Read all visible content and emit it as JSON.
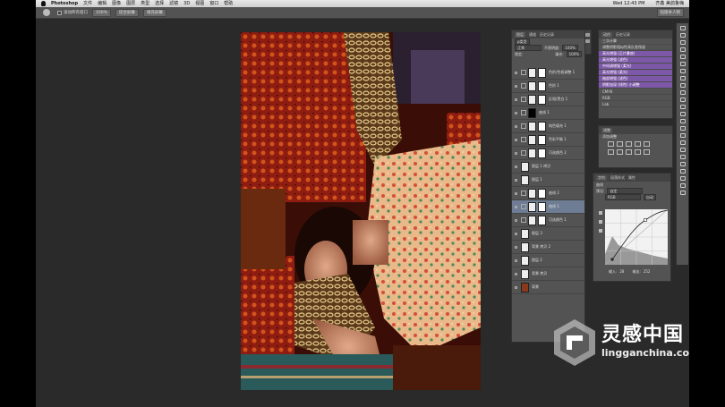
{
  "menubar": {
    "app": "Photoshop",
    "items": [
      "文件",
      "编辑",
      "图像",
      "图层",
      "类型",
      "选择",
      "滤镜",
      "3D",
      "视图",
      "窗口",
      "帮助"
    ],
    "clock": "Wed 12:43 PM",
    "user": "齐鑫 美鸽鲁嗨"
  },
  "options": {
    "checkbox_label": "滚动所有窗口",
    "btn1": "100%",
    "btn2": "适合屏幕",
    "btn3": "填充屏幕",
    "workspace": "短版本人物"
  },
  "layers_panel": {
    "tabs": [
      "图层",
      "通道",
      "历史记录"
    ],
    "kind": "ρ类型",
    "blend": "正常",
    "opacity_label": "不透明度:",
    "opacity": "100%",
    "lock_label": "锁定:",
    "fill_label": "填充:",
    "fill": "100%",
    "layers": [
      {
        "name": "色阶/色相调整 1",
        "type": "adj"
      },
      {
        "name": "色阶 1",
        "type": "adj"
      },
      {
        "name": "反相/黑白 1",
        "type": "grad"
      },
      {
        "name": "曲线 1",
        "type": "black"
      },
      {
        "name": "纯色填充 1",
        "type": "adj"
      },
      {
        "name": "色彩平衡 1",
        "type": "adj"
      },
      {
        "name": "可选颜色 2",
        "type": "adj"
      },
      {
        "name": "图层 1 拷贝",
        "type": "plain"
      },
      {
        "name": "图层 1",
        "type": "plain"
      },
      {
        "name": "曲线 2",
        "type": "adj"
      },
      {
        "name": "曲线 1",
        "type": "adj"
      },
      {
        "name": "可选颜色 1",
        "type": "adj"
      },
      {
        "name": "图层 3",
        "type": "plain"
      },
      {
        "name": "背景 拷贝 2",
        "type": "plain"
      },
      {
        "name": "图层 2",
        "type": "plain"
      },
      {
        "name": "背景 拷贝",
        "type": "plain"
      },
      {
        "name": "背景",
        "type": "photo"
      }
    ]
  },
  "history_panel": {
    "tabs": [
      "动作",
      "历史记录"
    ],
    "items": [
      {
        "label": "三次计算",
        "hl": false
      },
      {
        "label": "调整阴影相似性高反差保留",
        "hl": false
      },
      {
        "label": "高光增强 (正片叠底)",
        "hl": true
      },
      {
        "label": "高光增强 (滤色)",
        "hl": true
      },
      {
        "label": "中间调增强 (柔光)",
        "hl": true
      },
      {
        "label": "高光增强 (柔光)",
        "hl": true
      },
      {
        "label": "暗部增强 (滤色)",
        "hl": true
      },
      {
        "label": "阴影加深 (线性) 小调整",
        "hl": true
      },
      {
        "label": "CMYK",
        "hl": false
      },
      {
        "label": "RGB",
        "hl": false
      },
      {
        "label": "Lab",
        "hl": false
      }
    ]
  },
  "adjust_panel": {
    "tab": "调整",
    "label": "添加调整"
  },
  "properties_panel": {
    "tabs": [
      "字符",
      "段落样式",
      "属性"
    ],
    "title": "曲线",
    "preset_label": "预设:",
    "preset": "自定",
    "channel": "RGB",
    "auto": "自动",
    "input_label": "输入:",
    "input": "28",
    "output_label": "输出:",
    "output": "252"
  },
  "watermark": {
    "title": "灵感中国",
    "url": "lingganchina.com",
    "reg": "®"
  },
  "colors": {
    "accent_history": "#7d58a8",
    "active_layer": "#6e7d93",
    "panel": "#535353"
  }
}
